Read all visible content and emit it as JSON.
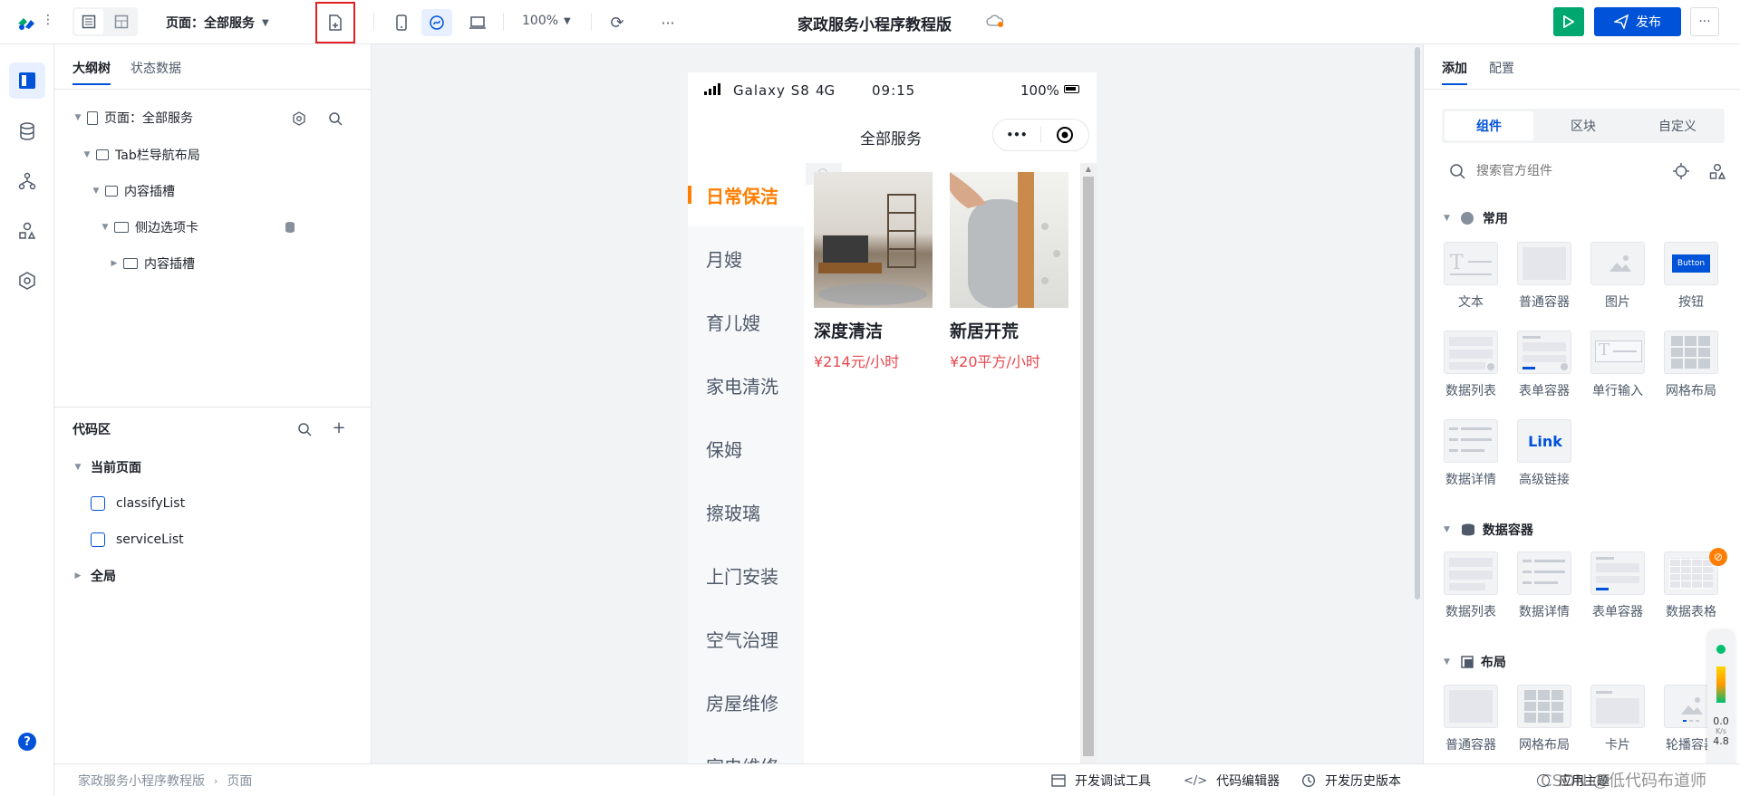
{
  "app": {
    "title": "家政服务小程序教程版",
    "page_selector": "页面：全部服务",
    "zoom": "100%",
    "publish_label": "发布"
  },
  "left": {
    "tabs": [
      "大纲树",
      "状态数据"
    ],
    "tree": [
      {
        "label": "页面：全部服务"
      },
      {
        "label": "Tab栏导航布局"
      },
      {
        "label": "内容插槽"
      },
      {
        "label": "侧边选项卡"
      },
      {
        "label": "内容插槽"
      }
    ],
    "code_title": "代码区",
    "current_page": "当前页面",
    "code_items": [
      "classifyList",
      "serviceList"
    ],
    "global": "全局"
  },
  "phone": {
    "carrier": "Galaxy S8",
    "network": "4G",
    "time": "09:15",
    "battery": "100%",
    "page_title": "全部服务",
    "more_glyph": "•••",
    "categories": [
      "日常保洁",
      "月嫂",
      "育儿嫂",
      "家电清洗",
      "保姆",
      "擦玻璃",
      "上门安装",
      "空气治理",
      "房屋维修",
      "家电维修"
    ],
    "services": [
      {
        "name": "深度清洁",
        "price": "¥214元/小时"
      },
      {
        "name": "新居开荒",
        "price": "¥20平方/小时"
      }
    ]
  },
  "right": {
    "tabs": [
      "添加",
      "配置"
    ],
    "segments": [
      "组件",
      "区块",
      "自定义"
    ],
    "search_placeholder": "搜索官方组件",
    "sections": {
      "common": "常用",
      "data_container": "数据容器",
      "layout": "布局"
    },
    "common_items": [
      "文本",
      "普通容器",
      "图片",
      "按钮",
      "数据列表",
      "表单容器",
      "单行输入",
      "网格布局",
      "数据详情",
      "高级链接"
    ],
    "button_thumb": "Button",
    "link_thumb": "Link",
    "data_items": [
      "数据列表",
      "数据详情",
      "表单容器",
      "数据表格"
    ],
    "layout_items": [
      "普通容器",
      "网格布局",
      "卡片",
      "轮播容器"
    ],
    "perf": {
      "value": "0.0",
      "unit": "K/s",
      "sub": "4.8"
    }
  },
  "bottom": {
    "breadcrumb": [
      "家政服务小程序教程版",
      "页面"
    ],
    "tools": [
      "开发调试工具",
      "代码编辑器",
      "开发历史版本"
    ],
    "theme": "应用主题",
    "watermark": "CSDN @低代码布道师"
  },
  "colors": {
    "brand": "#0052d9",
    "accent": "#ff7d00",
    "price": "#e5484d",
    "green": "#00a870"
  }
}
